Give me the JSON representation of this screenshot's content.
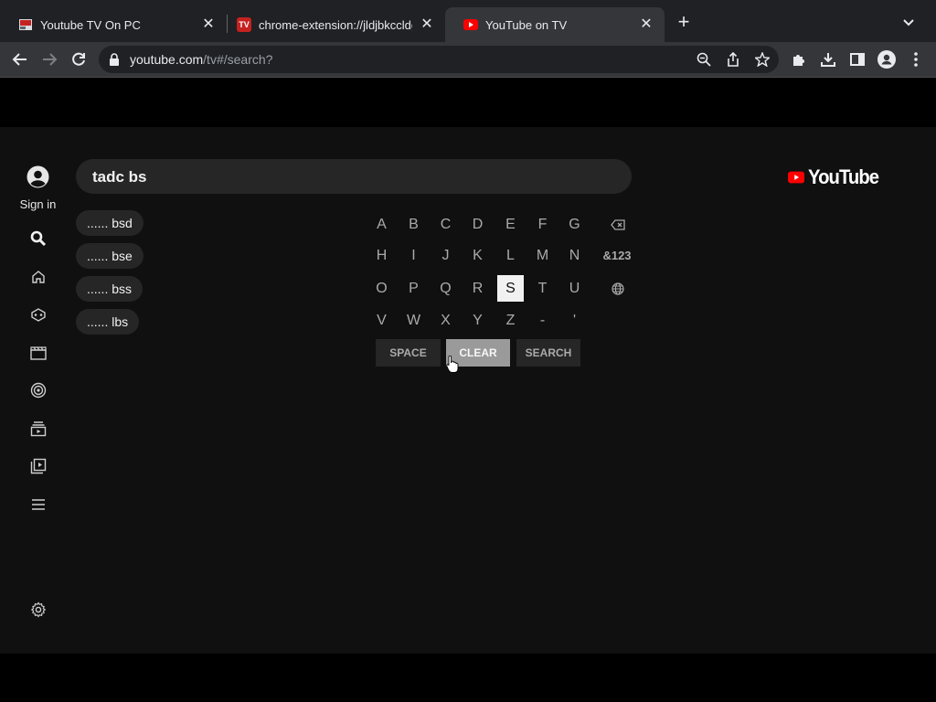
{
  "browser": {
    "tabs": [
      {
        "title": "Youtube TV On PC",
        "favicon": "page-thumbnail-icon",
        "active": false
      },
      {
        "title": "chrome-extension://jldjbkccldg",
        "favicon": "tv-extension-icon",
        "favicon_text": "TV",
        "active": false
      },
      {
        "title": "YouTube on TV",
        "favicon": "youtube-icon",
        "active": true
      }
    ],
    "url_host": "youtube.com",
    "url_path": "/tv#/search?"
  },
  "sidebar": {
    "signin_label": "Sign in",
    "items": [
      {
        "icon": "search-icon"
      },
      {
        "icon": "home-icon"
      },
      {
        "icon": "gaming-icon"
      },
      {
        "icon": "movies-icon"
      },
      {
        "icon": "live-icon"
      },
      {
        "icon": "subscriptions-icon"
      },
      {
        "icon": "library-icon"
      },
      {
        "icon": "menu-icon"
      },
      {
        "icon": "settings-icon"
      }
    ]
  },
  "search": {
    "query": "tadc bs",
    "suggestions": [
      "...... bsd",
      "...... bse",
      "...... bss",
      "...... lbs"
    ]
  },
  "keyboard": {
    "rows": [
      [
        "A",
        "B",
        "C",
        "D",
        "E",
        "F",
        "G"
      ],
      [
        "H",
        "I",
        "J",
        "K",
        "L",
        "M",
        "N"
      ],
      [
        "O",
        "P",
        "Q",
        "R",
        "S",
        "T",
        "U"
      ],
      [
        "V",
        "W",
        "X",
        "Y",
        "Z",
        "-",
        "'"
      ]
    ],
    "selected_key": "S",
    "symbols_label": "&123",
    "actions": [
      "SPACE",
      "CLEAR",
      "SEARCH"
    ],
    "hovered_action": "CLEAR"
  },
  "brand": {
    "logo_text": "YouTube",
    "accent": "#ff0000"
  },
  "colors": {
    "app_bg": "#101010",
    "chip_bg": "#262626",
    "selected_key_bg": "#f1f1f1"
  }
}
